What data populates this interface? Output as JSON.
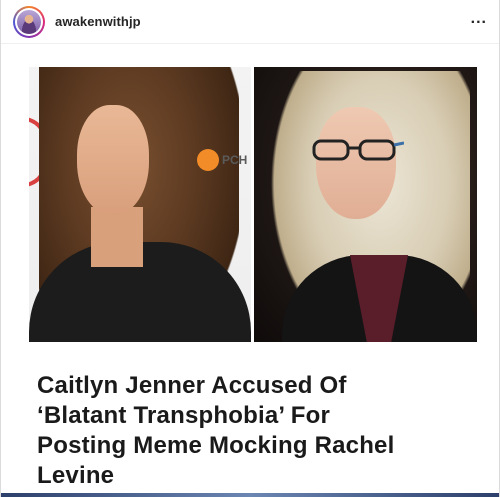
{
  "post": {
    "username": "awakenwithjp",
    "more_icon": "more-horizontal-icon",
    "more_label": "..."
  },
  "media": {
    "left_logo_text": "PCH",
    "headline": [
      "Caitlyn Jenner Accused Of",
      "‘Blatant Transphobia’ For",
      "Posting Meme Mocking Rachel",
      "Levine"
    ]
  },
  "colors": {
    "text": "#262626",
    "border": "#dbdbdb",
    "headline": "#1a1a1a",
    "logo_orange": "#f28c28"
  }
}
